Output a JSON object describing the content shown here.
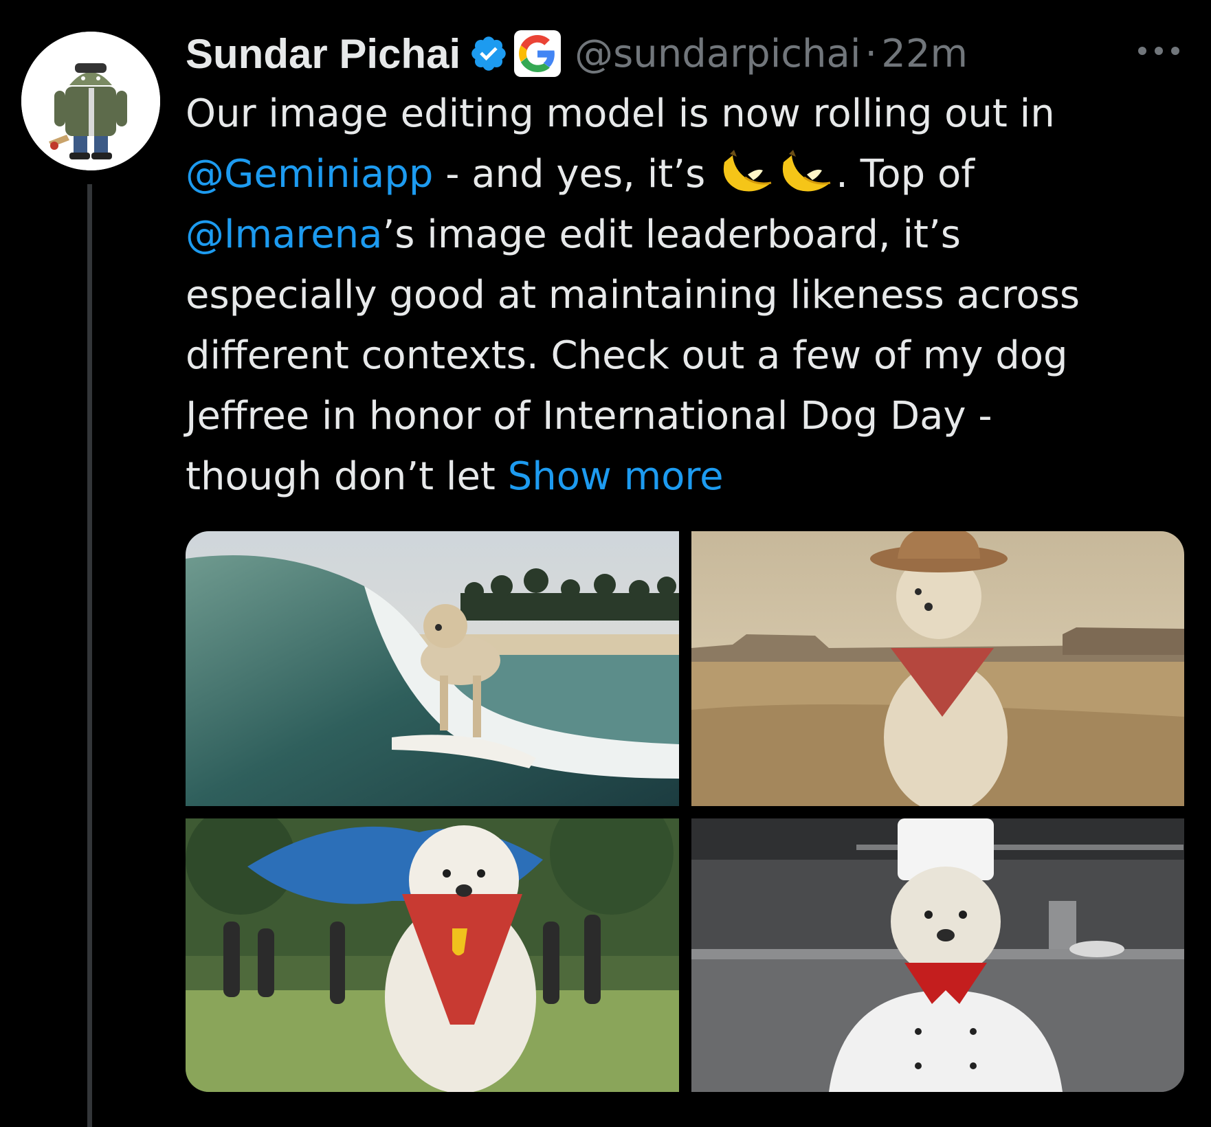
{
  "author": {
    "name": "Sundar Pichai",
    "handle": "@sundarpichai",
    "separator": "·",
    "time": "22m",
    "avatar_icon": "android-figure-avatar",
    "verified_icon": "verified-badge-icon",
    "affiliation_icon": "google-g-logo"
  },
  "tweet": {
    "line1": "Our image editing model is now rolling out in",
    "mention_gemini": "@Geminiapp",
    "line2_mid": " - and yes, it’s ",
    "line2_end": ". Top of",
    "mention_lmarena": "@lmarena",
    "line3_end": "’s image edit leaderboard, it’s",
    "line4": "especially good at maintaining likeness across",
    "line5": "different contexts. Check out a few of my dog",
    "line6": "Jeffree in honor of International Dog Day -",
    "line7_start": "though don’t let ",
    "show_more": "Show more",
    "emoji": [
      "banana-emoji",
      "banana-emoji"
    ]
  },
  "media": [
    {
      "name": "dog-surfing-image"
    },
    {
      "name": "dog-cowboy-image"
    },
    {
      "name": "dog-superhero-image"
    },
    {
      "name": "dog-chef-image"
    }
  ],
  "colors": {
    "background": "#000000",
    "text": "#e7e9ea",
    "secondary": "#71767b",
    "link": "#1d9bf0",
    "verified": "#1d9bf0"
  }
}
